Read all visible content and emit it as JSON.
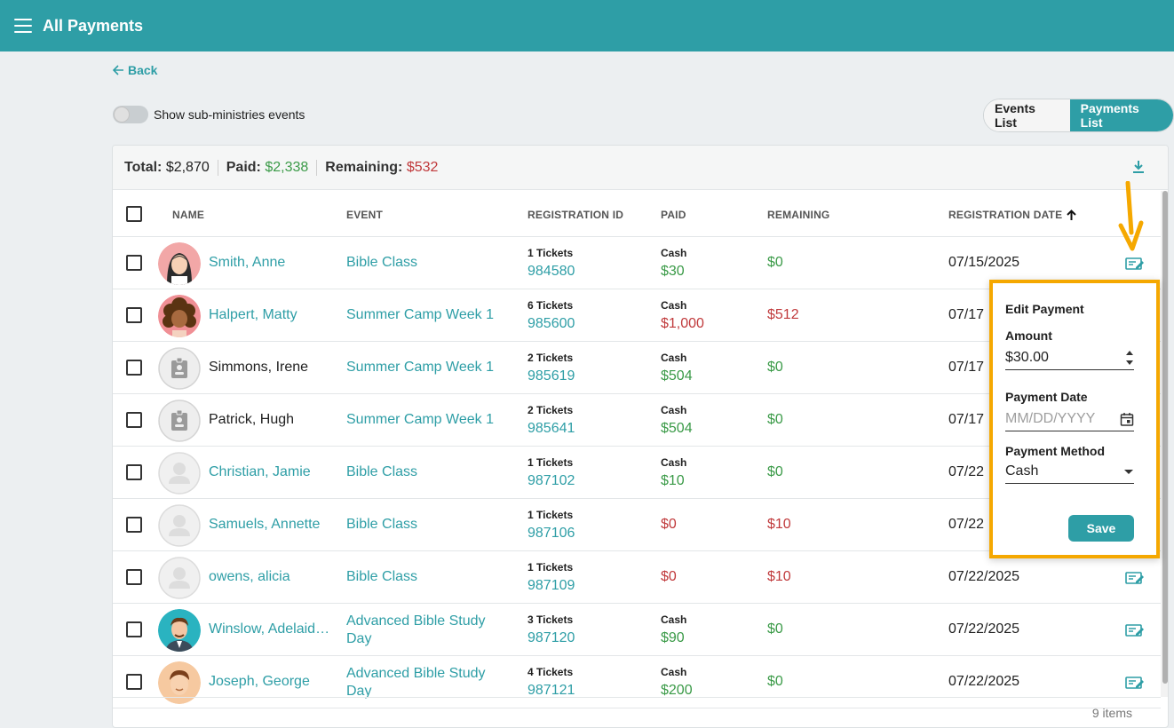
{
  "header": {
    "title": "All Payments"
  },
  "nav": {
    "back_label": "Back"
  },
  "filters": {
    "sub_ministries_label": "Show sub-ministries events",
    "sub_ministries_on": false
  },
  "view_toggle": {
    "events_label": "Events List",
    "payments_label": "Payments List",
    "active": "Payments List"
  },
  "summary": {
    "total_label": "Total:",
    "total_value": "$2,870",
    "paid_label": "Paid:",
    "paid_value": "$2,338",
    "remaining_label": "Remaining:",
    "remaining_value": "$532"
  },
  "table": {
    "columns": [
      "NAME",
      "EVENT",
      "REGISTRATION ID",
      "PAID",
      "REMAINING",
      "REGISTRATION DATE"
    ],
    "sort_column": "REGISTRATION DATE",
    "rows": [
      {
        "name": "Smith, Anne",
        "name_link": true,
        "avatar": "girl-avatar",
        "event": "Bible Class",
        "tickets": "1 Tickets",
        "reg_id": "984580",
        "method": "Cash",
        "paid": "$30",
        "paid_status": "green",
        "remaining": "$0",
        "remaining_status": "green",
        "date": "07/15/2025"
      },
      {
        "name": "Halpert, Matty",
        "name_link": true,
        "avatar": "curly-girl-avatar",
        "event": "Summer Camp Week 1",
        "tickets": "6 Tickets",
        "reg_id": "985600",
        "method": "Cash",
        "paid": "$1,000",
        "paid_status": "red",
        "remaining": "$512",
        "remaining_status": "red",
        "date": "07/17"
      },
      {
        "name": "Simmons, Irene",
        "name_link": false,
        "avatar": "badge-avatar",
        "event": "Summer Camp Week 1",
        "tickets": "2 Tickets",
        "reg_id": "985619",
        "method": "Cash",
        "paid": "$504",
        "paid_status": "green",
        "remaining": "$0",
        "remaining_status": "green",
        "date": "07/17"
      },
      {
        "name": "Patrick, Hugh",
        "name_link": false,
        "avatar": "badge-avatar",
        "event": "Summer Camp Week 1",
        "tickets": "2 Tickets",
        "reg_id": "985641",
        "method": "Cash",
        "paid": "$504",
        "paid_status": "green",
        "remaining": "$0",
        "remaining_status": "green",
        "date": "07/17"
      },
      {
        "name": "Christian, Jamie",
        "name_link": true,
        "avatar": "person-placeholder-avatar",
        "event": "Bible Class",
        "tickets": "1 Tickets",
        "reg_id": "987102",
        "method": "Cash",
        "paid": "$10",
        "paid_status": "green",
        "remaining": "$0",
        "remaining_status": "green",
        "date": "07/22"
      },
      {
        "name": "Samuels, Annette",
        "name_link": true,
        "avatar": "person-placeholder-avatar",
        "event": "Bible Class",
        "tickets": "1 Tickets",
        "reg_id": "987106",
        "method": "",
        "paid": "$0",
        "paid_status": "red",
        "remaining": "$10",
        "remaining_status": "red",
        "date": "07/22"
      },
      {
        "name": "owens, alicia",
        "name_link": true,
        "avatar": "person-placeholder-avatar",
        "event": "Bible Class",
        "tickets": "1 Tickets",
        "reg_id": "987109",
        "method": "",
        "paid": "$0",
        "paid_status": "red",
        "remaining": "$10",
        "remaining_status": "red",
        "date": "07/22/2025"
      },
      {
        "name": "Winslow, Adelaid…",
        "name_link": true,
        "avatar": "man-avatar",
        "event": "Advanced Bible Study Day",
        "tickets": "3 Tickets",
        "reg_id": "987120",
        "method": "Cash",
        "paid": "$90",
        "paid_status": "green",
        "remaining": "$0",
        "remaining_status": "green",
        "date": "07/22/2025"
      },
      {
        "name": "Joseph, George",
        "name_link": true,
        "avatar": "boy-avatar",
        "event": "Advanced Bible Study Day",
        "tickets": "4 Tickets",
        "reg_id": "987121",
        "method": "Cash",
        "paid": "$200",
        "paid_status": "green",
        "remaining": "$0",
        "remaining_status": "green",
        "date": "07/22/2025"
      }
    ],
    "footer_count": "9 items"
  },
  "edit_popup": {
    "title": "Edit Payment",
    "amount_label": "Amount",
    "amount_value": "$30.00",
    "date_label": "Payment Date",
    "date_placeholder": "MM/DD/YYYY",
    "method_label": "Payment Method",
    "method_value": "Cash",
    "save_label": "Save"
  },
  "colors": {
    "brand": "#2e9ea6",
    "paid": "#3a9a47",
    "due": "#c0393b",
    "highlight": "#f5a800"
  }
}
